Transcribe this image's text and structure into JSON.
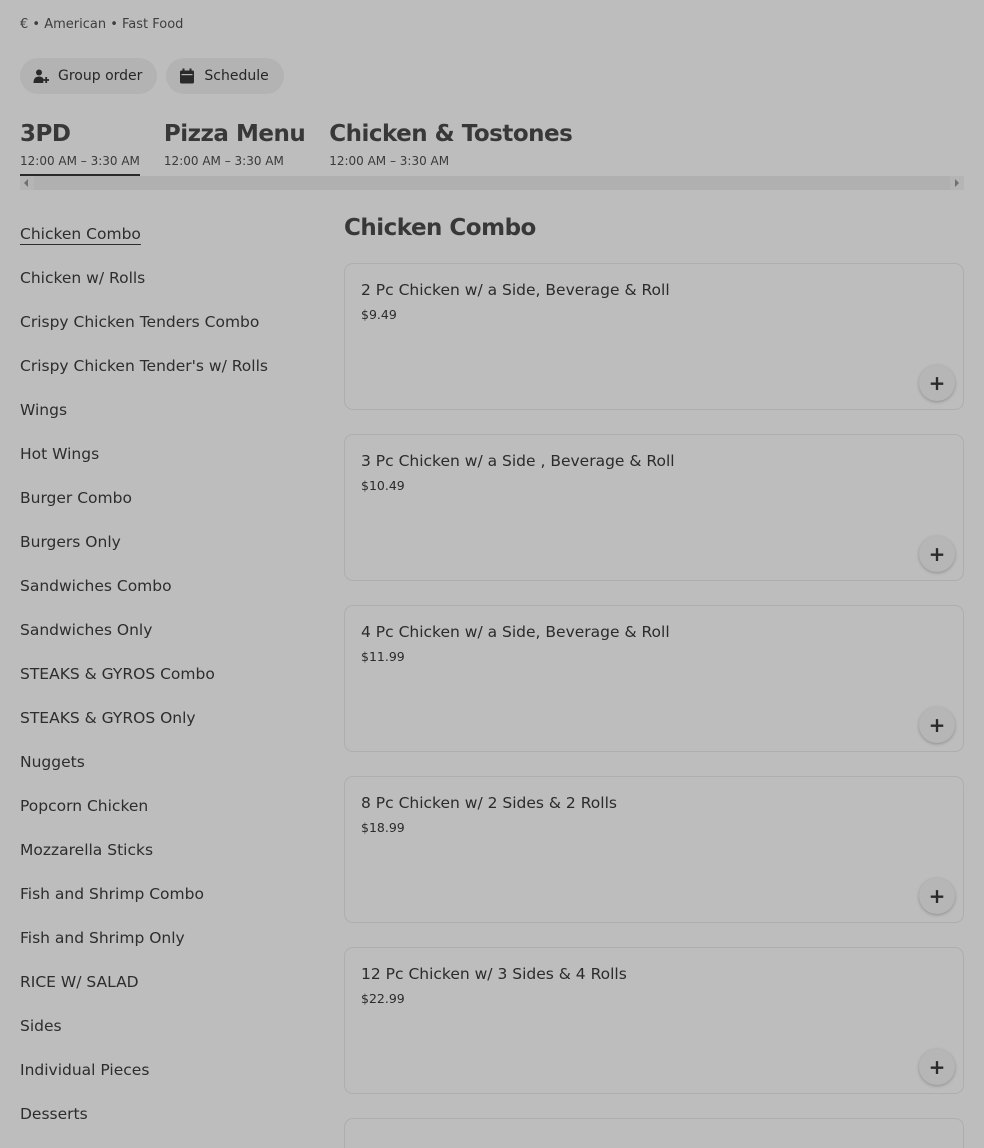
{
  "store": {
    "meta": "€ • American • Fast Food",
    "group_order_label": "Group order",
    "schedule_label": "Schedule"
  },
  "menus": [
    {
      "name": "3PD",
      "hours": "12:00 AM – 3:30 AM",
      "active": true
    },
    {
      "name": "Pizza Menu",
      "hours": "12:00 AM – 3:30 AM",
      "active": false
    },
    {
      "name": "Chicken & Tostones",
      "hours": "12:00 AM – 3:30 AM",
      "active": false
    }
  ],
  "categories": [
    "Chicken Combo",
    "Chicken w/ Rolls",
    "Crispy Chicken Tenders Combo",
    "Crispy Chicken Tender's w/ Rolls",
    "Wings",
    "Hot Wings",
    "Burger Combo",
    "Burgers Only",
    "Sandwiches Combo",
    "Sandwiches Only",
    "STEAKS & GYROS Combo",
    "STEAKS & GYROS Only",
    "Nuggets",
    "Popcorn Chicken",
    "Mozzarella Sticks",
    "Fish and Shrimp Combo",
    "Fish and Shrimp Only",
    "RICE W/ SALAD",
    "Sides",
    "Individual Pieces",
    "Desserts"
  ],
  "section": {
    "title": "Chicken Combo",
    "items": [
      {
        "title": "2 Pc Chicken w/ a Side, Beverage & Roll",
        "price": "$9.49"
      },
      {
        "title": "3 Pc Chicken w/ a Side , Beverage & Roll",
        "price": "$10.49"
      },
      {
        "title": "4 Pc Chicken w/ a Side, Beverage & Roll",
        "price": "$11.99"
      },
      {
        "title": "8 Pc Chicken w/ 2 Sides & 2 Rolls",
        "price": "$18.99"
      },
      {
        "title": "12 Pc Chicken w/ 3 Sides & 4 Rolls",
        "price": "$22.99"
      }
    ],
    "add_glyph": "+"
  }
}
